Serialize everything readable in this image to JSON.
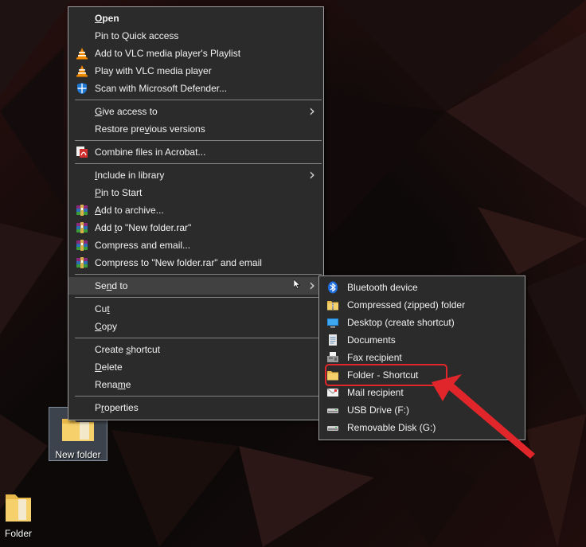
{
  "main_menu": {
    "items": [
      {
        "label": "Open",
        "bold": true,
        "icon": null,
        "submenu": false
      },
      {
        "label": "Pin to Quick access",
        "icon": null,
        "submenu": false
      },
      {
        "label": "Add to VLC media player's Playlist",
        "icon": "vlc-icon",
        "submenu": false
      },
      {
        "label": "Play with VLC media player",
        "icon": "vlc-icon",
        "submenu": false
      },
      {
        "label": "Scan with Microsoft Defender...",
        "icon": "defender-icon",
        "submenu": false
      },
      {
        "separator": true
      },
      {
        "label": "Give access to",
        "icon": null,
        "submenu": true
      },
      {
        "label": "Restore previous versions",
        "icon": null,
        "submenu": false
      },
      {
        "separator": true
      },
      {
        "label": "Combine files in Acrobat...",
        "icon": "acrobat-icon",
        "submenu": false
      },
      {
        "separator": true
      },
      {
        "label": "Include in library",
        "icon": null,
        "submenu": true
      },
      {
        "label": "Pin to Start",
        "icon": null,
        "submenu": false
      },
      {
        "label": "Add to archive...",
        "icon": "winrar-icon",
        "submenu": false
      },
      {
        "label": "Add to \"New folder.rar\"",
        "icon": "winrar-icon",
        "submenu": false
      },
      {
        "label": "Compress and email...",
        "icon": "winrar-icon",
        "submenu": false
      },
      {
        "label": "Compress to \"New folder.rar\" and email",
        "icon": "winrar-icon",
        "submenu": false
      },
      {
        "separator": true
      },
      {
        "label": "Send to",
        "icon": null,
        "submenu": true,
        "hover": true
      },
      {
        "separator": true
      },
      {
        "label": "Cut",
        "icon": null,
        "submenu": false
      },
      {
        "label": "Copy",
        "icon": null,
        "submenu": false
      },
      {
        "separator": true
      },
      {
        "label": "Create shortcut",
        "icon": null,
        "submenu": false
      },
      {
        "label": "Delete",
        "icon": null,
        "submenu": false
      },
      {
        "label": "Rename",
        "icon": null,
        "submenu": false
      },
      {
        "separator": true
      },
      {
        "label": "Properties",
        "icon": null,
        "submenu": false
      }
    ]
  },
  "send_to_menu": {
    "items": [
      {
        "label": "Bluetooth device",
        "icon": "bluetooth-icon"
      },
      {
        "label": "Compressed (zipped) folder",
        "icon": "zip-folder-icon"
      },
      {
        "label": "Desktop (create shortcut)",
        "icon": "desktop-icon"
      },
      {
        "label": "Documents",
        "icon": "documents-icon"
      },
      {
        "label": "Fax recipient",
        "icon": "fax-icon"
      },
      {
        "label": "Folder - Shortcut",
        "icon": "folder-icon"
      },
      {
        "label": "Mail recipient",
        "icon": "mail-icon"
      },
      {
        "label": "USB Drive (F:)",
        "icon": "usb-drive-icon"
      },
      {
        "label": "Removable Disk (G:)",
        "icon": "removable-disk-icon"
      }
    ]
  },
  "desktop": {
    "selected_icon_label": "New folder",
    "other_icon_label": "Folder"
  },
  "colors": {
    "menu_bg": "#2b2b2b",
    "hover_bg": "#414141",
    "annotation_red": "#e0262a"
  }
}
